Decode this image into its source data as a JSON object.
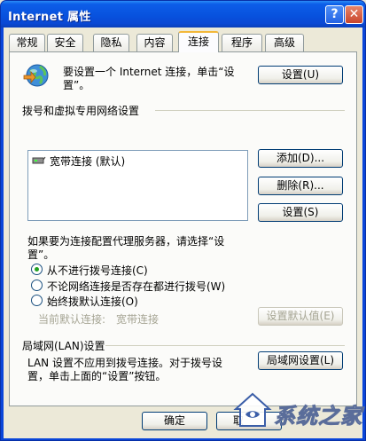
{
  "window": {
    "title": "Internet 属性",
    "help": "?",
    "close": "✕"
  },
  "tabs": [
    "常规",
    "安全",
    "隐私",
    "内容",
    "连接",
    "程序",
    "高级"
  ],
  "active_tab": "连接",
  "setup": {
    "text_line1": "要设置一个 Internet 连接，单击“设",
    "text_line2": "置”。",
    "button": "设置(U)",
    "icon": "globe-network-icon"
  },
  "dialup": {
    "group_title": "拨号和虚拟专用网络设置",
    "connection": "宽带连接 (默认)",
    "add_button": "添加(D)...",
    "remove_button": "删除(R)...",
    "settings_button": "设置(S)",
    "proxy_note_line1": "如果要为连接配置代理服务器，请选择“设",
    "proxy_note_line2": "置”。",
    "options": [
      {
        "label": "从不进行拨号连接(C)",
        "selected": true
      },
      {
        "label": "不论网络连接是否存在都进行拨号(W)",
        "selected": false
      },
      {
        "label": "始终拨默认连接(O)",
        "selected": false
      }
    ],
    "current_default_label": "当前默认连接:",
    "current_default_value": "宽带连接",
    "set_default_button": "设置默认值(E)"
  },
  "lan": {
    "group_title": "局域网(LAN)设置",
    "text_line1": "LAN 设置不应用到拨号连接。对于拨号设",
    "text_line2": "置，单击上面的“设置”按钮。",
    "button": "局域网设置(L)"
  },
  "footer": {
    "ok": "确定",
    "cancel": "取"
  },
  "watermark": {
    "text": "系统之家",
    "icon": "house-logo-icon"
  }
}
